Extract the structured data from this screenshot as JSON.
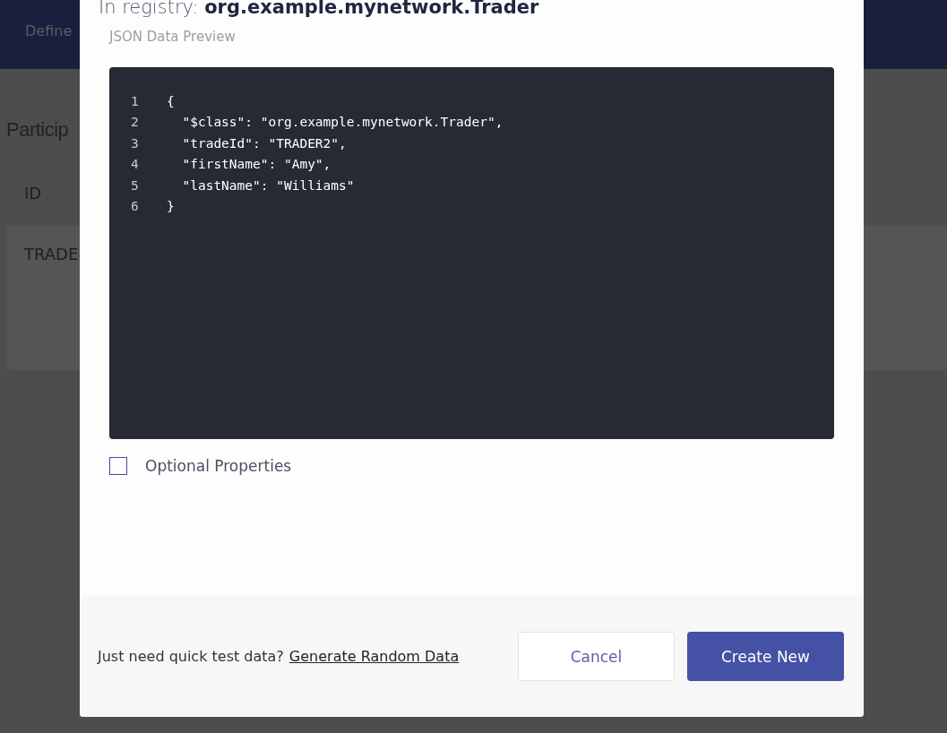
{
  "background": {
    "nav_item": "Define",
    "heading": "Particip",
    "table_header": "ID",
    "table_cell": "TRADE"
  },
  "dialog": {
    "registry_label": "In registry:",
    "registry_name": "org.example.mynetwork.Trader",
    "preview_label": "JSON Data Preview",
    "code_lines": [
      {
        "number": "1",
        "text": "{"
      },
      {
        "number": "2",
        "text": "  \"$class\": \"org.example.mynetwork.Trader\","
      },
      {
        "number": "3",
        "text": "  \"tradeId\": \"TRADER2\","
      },
      {
        "number": "4",
        "text": "  \"firstName\": \"Amy\","
      },
      {
        "number": "5",
        "text": "  \"lastName\": \"Williams\""
      },
      {
        "number": "6",
        "text": "}"
      }
    ],
    "optional_properties": {
      "label": "Optional Properties",
      "checked": false
    },
    "hint": "Just need quick test data?",
    "generate_link": "Generate Random Data",
    "buttons": [
      {
        "label": "Cancel",
        "kind": "secondary"
      },
      {
        "label": "Create New",
        "kind": "primary"
      }
    ]
  }
}
